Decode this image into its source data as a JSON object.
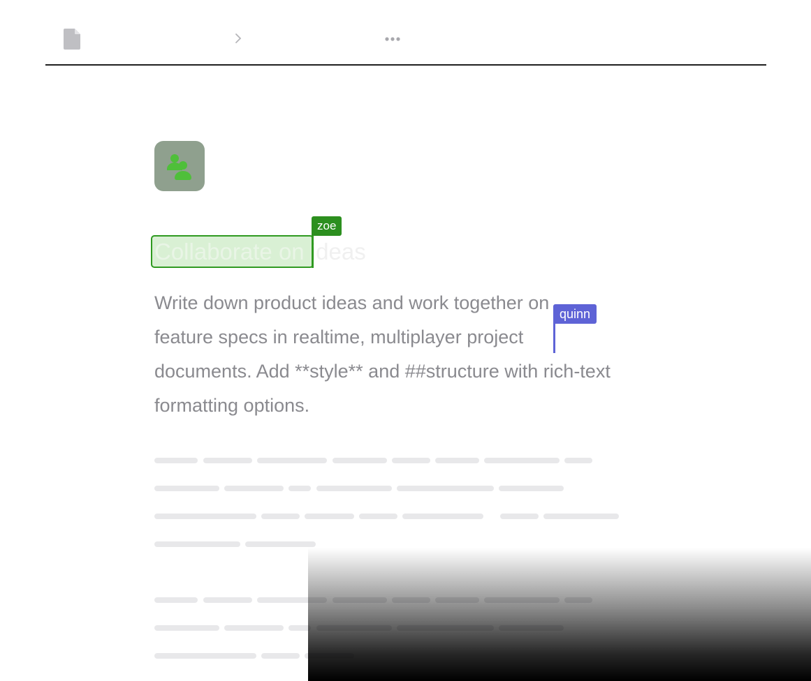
{
  "header": {
    "doc_icon": "document-icon",
    "separator_icon": "chevron-right-icon",
    "more_icon": "more-horizontal-icon"
  },
  "page_icon": {
    "icon": "users-icon",
    "background": "#8fa08e",
    "foreground": "#4fbf3a"
  },
  "title": {
    "selected_text": "Collaborate on",
    "rest_text": "ideas"
  },
  "cursors": {
    "zoe": {
      "name": "zoe",
      "color": "#2c8f1f"
    },
    "quinn": {
      "name": "quinn",
      "color": "#5e63d6"
    }
  },
  "body": {
    "line1": "Write down product ideas and work together on",
    "line2": "feature specs in realtime, multiplayer project",
    "line3": "documents. Add **style** and ##structure with rich-text",
    "line4": "formatting options."
  }
}
